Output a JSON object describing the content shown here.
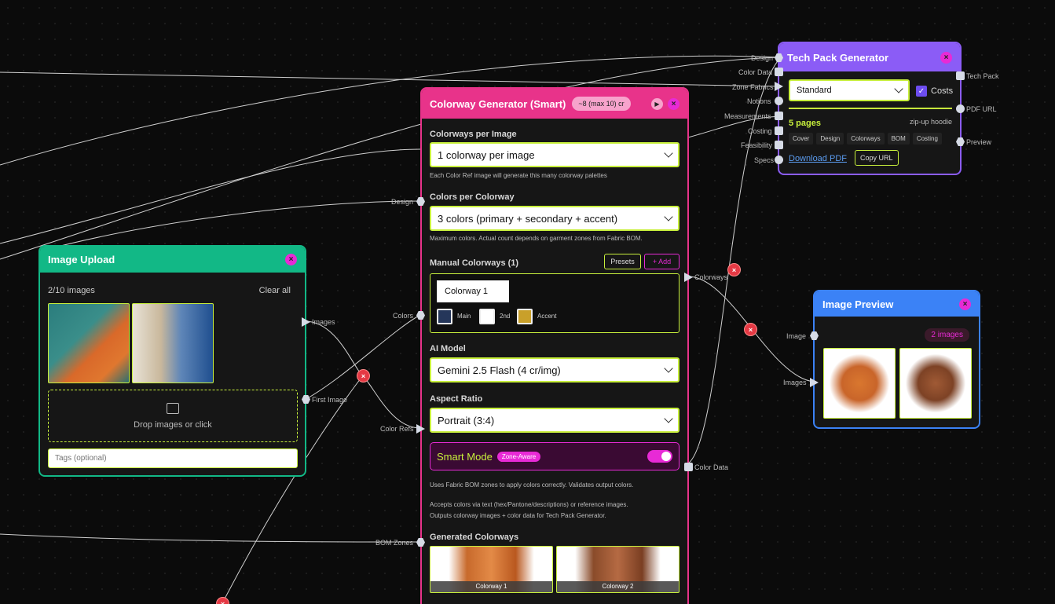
{
  "colorway_node": {
    "title": "Colorway Generator (Smart)",
    "cost_badge": "~8 (max 10) cr",
    "colorways_per_image": {
      "label": "Colorways per Image",
      "value": "1 colorway per image",
      "hint": "Each Color Ref image will generate this many colorway palettes"
    },
    "colors_per_colorway": {
      "label": "Colors per Colorway",
      "value": "3 colors (primary + secondary + accent)",
      "hint": "Maximum colors. Actual count depends on garment zones from Fabric BOM."
    },
    "manual": {
      "label": "Manual Colorways (1)",
      "presets": "Presets",
      "add": "+ Add",
      "colorway_name": "Colorway 1",
      "swatches": [
        {
          "label": "Main",
          "color": "#25365a"
        },
        {
          "label": "2nd",
          "color": "#ffffff"
        },
        {
          "label": "Accent",
          "color": "#c9a02a"
        }
      ]
    },
    "ai_model": {
      "label": "AI Model",
      "value": "Gemini 2.5 Flash (4 cr/img)"
    },
    "aspect": {
      "label": "Aspect Ratio",
      "value": "Portrait (3:4)"
    },
    "smart": {
      "label": "Smart Mode",
      "badge": "Zone-Aware",
      "enabled": true
    },
    "smart_hint": "Uses Fabric BOM zones to apply colors correctly. Validates output colors.",
    "accept_hint_1": "Accepts colors via text (hex/Pantone/descriptions) or reference images.",
    "accept_hint_2": "Outputs colorway images + color data for Tech Pack Generator.",
    "generated": {
      "label": "Generated Colorways",
      "items": [
        "Colorway 1",
        "Colorway 2"
      ]
    },
    "ports_in": {
      "design": "Design",
      "colors": "Colors",
      "color_refs": "Color Refs",
      "bom_zones": "BOM Zones"
    },
    "ports_out": {
      "colorways": "Colorways",
      "color_data": "Color Data"
    }
  },
  "upload_node": {
    "title": "Image Upload",
    "count": "2/10 images",
    "clear": "Clear all",
    "drop": "Drop images or click",
    "tags_placeholder": "Tags (optional)",
    "ports_out": {
      "images": "Images",
      "first": "First Image"
    }
  },
  "techpack_node": {
    "title": "Tech Pack Generator",
    "template": "Standard",
    "costs_label": "Costs",
    "costs_checked": true,
    "pages": "5 pages",
    "product": "zip-up hoodie",
    "tabs": [
      "Cover",
      "Design",
      "Colorways",
      "BOM",
      "Costing"
    ],
    "download": "Download PDF",
    "copy": "Copy URL",
    "ports_in": [
      "Design",
      "Color Data",
      "Zone Fabrics",
      "Notions",
      "Measurements",
      "Costing",
      "Feasibility",
      "Specs"
    ],
    "ports_out": [
      "Tech Pack",
      "PDF URL",
      "Preview"
    ]
  },
  "preview_node": {
    "title": "Image Preview",
    "badge": "2 images",
    "ports_in": {
      "image": "Image",
      "images": "Images"
    }
  },
  "colors": {
    "pink": "#e8338a",
    "green": "#12b886",
    "purple": "#8b5cf6",
    "blue": "#3b82f6",
    "lime": "#c8f03c",
    "magenta": "#e82ad6"
  }
}
